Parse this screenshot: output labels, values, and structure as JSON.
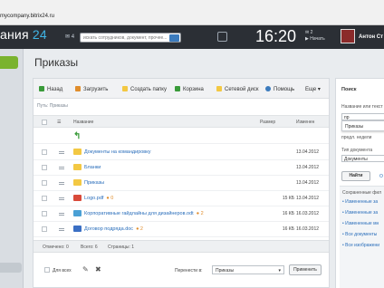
{
  "browser": {
    "url": "mycompany.bitrix24.ru"
  },
  "header": {
    "brand_text": "ания",
    "brand_num": "24",
    "messages_count": "4",
    "search_placeholder": "искать сотрудников, документ, прочее...",
    "time": "16:20",
    "clock_count": "2",
    "clock_label": "Начать",
    "user_name": "Антон Ст"
  },
  "page": {
    "title": "Приказы"
  },
  "toolbar": {
    "back": "Назад",
    "upload": "Загрузить",
    "create_folder": "Создать папку",
    "trash": "Корзина",
    "network_drive": "Сетевой диск",
    "help": "Помощь",
    "more": "Еще"
  },
  "breadcrumb": "Путь: Приказы",
  "table": {
    "col_name": "Название",
    "col_size": "Размер",
    "col_changed": "Изменен",
    "rows": [
      {
        "name": "Документы на командировку",
        "badge": "",
        "size": "",
        "date": "13.04.2012",
        "type": "folder"
      },
      {
        "name": "Бланки",
        "badge": "",
        "size": "",
        "date": "13.04.2012",
        "type": "folder"
      },
      {
        "name": "Приказы",
        "badge": "",
        "size": "",
        "date": "13.04.2012",
        "type": "folder"
      },
      {
        "name": "Logo.pdf",
        "badge": "0",
        "size": "15 КБ",
        "date": "13.04.2012",
        "type": "pdf"
      },
      {
        "name": "Корпоративные гайдлайны для дизайнеров.odt",
        "badge": "2",
        "size": "16 КБ",
        "date": "16.03.2012",
        "type": "odt"
      },
      {
        "name": "Договор подряда.doc",
        "badge": "2",
        "size": "16 КБ",
        "date": "16.03.2012",
        "type": "doc"
      }
    ]
  },
  "stats": {
    "selected": "Отмечено: 0",
    "total": "Всего: 6",
    "pages": "Страницы: 1"
  },
  "actions": {
    "for_all": "Для всех",
    "move_to": "Перенести в:",
    "move_target": "Приказы",
    "apply": "Применить"
  },
  "search_panel": {
    "title": "Поиск",
    "name_label": "Название или текст",
    "name_value": "пр",
    "suggestion": "Приказы",
    "date_hint": "предл. недели",
    "doctype_label": "Тип документа",
    "doctype_value": "Документы",
    "find": "Найти",
    "cancel": "О",
    "saved_title": "Сохраненные фил",
    "saved_items": [
      "Измененные за",
      "Измененные за",
      "Измененные мн",
      "Все документы",
      "Все изображени"
    ]
  }
}
